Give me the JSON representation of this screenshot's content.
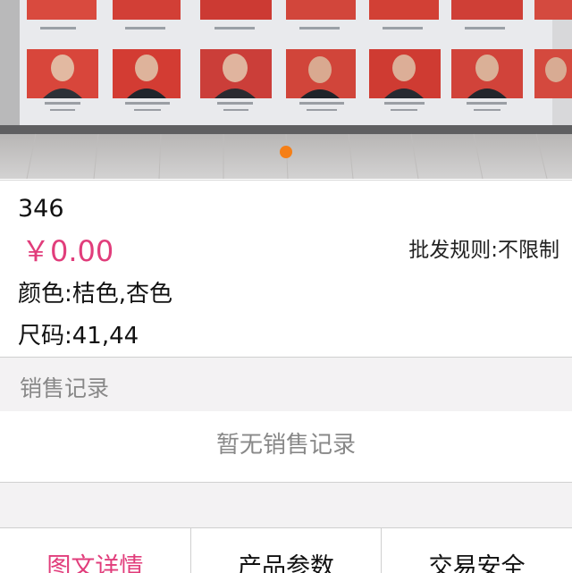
{
  "carousel": {
    "image_alt": "Group photo board",
    "active_index": 0,
    "dot_color": "#f57f17"
  },
  "product": {
    "name": "346",
    "price": "￥0.00",
    "wholesale_rule": "批发规则:不限制",
    "colors": "颜色:桔色,杏色",
    "sizes": "尺码:41,44"
  },
  "sales": {
    "title": "销售记录",
    "empty_text": "暂无销售记录"
  },
  "tabs": [
    {
      "label": "图文详情",
      "active": true
    },
    {
      "label": "产品参数",
      "active": false
    },
    {
      "label": "交易安全",
      "active": false
    }
  ],
  "colors": {
    "accent_pink": "#e13d7b",
    "muted_text": "#888888",
    "section_bg": "#f3f2f3"
  }
}
